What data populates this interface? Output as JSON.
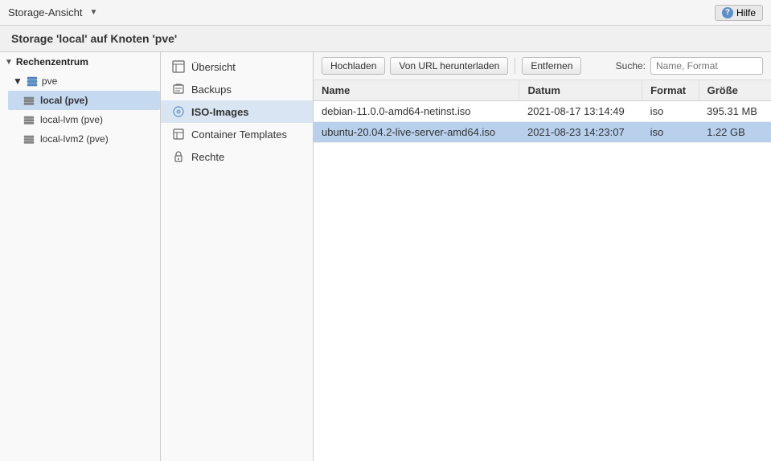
{
  "topbar": {
    "title": "Storage-Ansicht",
    "dropdown_icon": "▼",
    "help_label": "Hilfe",
    "help_icon": "?"
  },
  "page_title": "Storage 'local' auf Knoten 'pve'",
  "sidebar": {
    "group_label": "Rechenzentrum",
    "group_toggle": "▼",
    "subgroup_label": "pve",
    "subgroup_toggle": "▼",
    "items": [
      {
        "id": "local-pve",
        "label": "local (pve)",
        "selected": true
      },
      {
        "id": "local-lvm-pve",
        "label": "local-lvm (pve)",
        "selected": false
      },
      {
        "id": "local-lvm2-pve",
        "label": "local-lvm2 (pve)",
        "selected": false
      }
    ]
  },
  "nav": {
    "items": [
      {
        "id": "ubersicht",
        "label": "Übersicht",
        "icon": "📋"
      },
      {
        "id": "backups",
        "label": "Backups",
        "icon": "💾"
      },
      {
        "id": "iso-images",
        "label": "ISO-Images",
        "icon": "💿",
        "active": true
      },
      {
        "id": "container-templates",
        "label": "Container Templates",
        "icon": "📄"
      },
      {
        "id": "rechte",
        "label": "Rechte",
        "icon": "🔒"
      }
    ]
  },
  "toolbar": {
    "upload_label": "Hochladen",
    "download_url_label": "Von URL herunterladen",
    "remove_label": "Entfernen",
    "search_label": "Suche:",
    "search_placeholder": "Name, Format"
  },
  "table": {
    "columns": [
      {
        "id": "name",
        "label": "Name"
      },
      {
        "id": "datum",
        "label": "Datum"
      },
      {
        "id": "format",
        "label": "Format"
      },
      {
        "id": "grosse",
        "label": "Größe"
      }
    ],
    "rows": [
      {
        "name": "debian-11.0.0-amd64-netinst.iso",
        "datum": "2021-08-17 13:14:49",
        "format": "iso",
        "grosse": "395.31 MB",
        "selected": false
      },
      {
        "name": "ubuntu-20.04.2-live-server-amd64.iso",
        "datum": "2021-08-23 14:23:07",
        "format": "iso",
        "grosse": "1.22 GB",
        "selected": true
      }
    ]
  }
}
